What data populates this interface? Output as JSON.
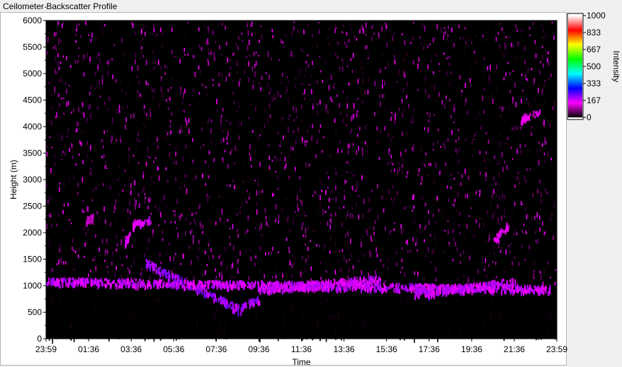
{
  "panel": {
    "title": "Ceilometer Backscatter Profile"
  },
  "chart_data": {
    "type": "heatmap",
    "title": "",
    "xlabel": "Time",
    "ylabel": "Height (m)",
    "x_ticks": [
      "23:59",
      "01:36",
      "03:36",
      "05:36",
      "07:36",
      "09:36",
      "11:36",
      "13:36",
      "15:36",
      "17:36",
      "19:36",
      "21:36",
      "23:59"
    ],
    "y_ticks": [
      0,
      500,
      1000,
      1500,
      2000,
      2500,
      3000,
      3500,
      4000,
      4500,
      5000,
      5500,
      6000
    ],
    "ylim": [
      0,
      6000
    ],
    "colorbar": {
      "label": "Intensity",
      "ticks": [
        1000,
        833,
        667,
        500,
        333,
        167,
        0
      ],
      "range": [
        0,
        1000
      ],
      "colors": [
        "#000000",
        "#ff00ff",
        "#0000ff",
        "#00ffff",
        "#00ff00",
        "#ffff00",
        "#ff0000",
        "#ffffff"
      ]
    },
    "layers": [
      {
        "name": "noise",
        "height_range": [
          1000,
          6000
        ],
        "intensity_range": [
          5,
          160
        ]
      },
      {
        "name": "boundary-layer",
        "height_range": [
          0,
          1000
        ],
        "intensity_range": [
          0,
          15
        ]
      }
    ],
    "features": [
      {
        "time_range": [
          "04:40",
          "09:10"
        ],
        "height_range": [
          1450,
          550
        ],
        "intensity": 200
      },
      {
        "time_range": [
          "09:10",
          "10:00"
        ],
        "height_range": [
          600,
          780
        ],
        "intensity": 190
      },
      {
        "time_range": [
          "10:00",
          "15:40"
        ],
        "height_range": [
          950,
          1150
        ],
        "intensity": 170
      },
      {
        "time_range": [
          "17:15",
          "22:00"
        ],
        "height_range": [
          850,
          1100
        ],
        "intensity": 175
      },
      {
        "time_range": [
          "23:40",
          "23:59"
        ],
        "height_range": [
          950,
          1100
        ],
        "intensity": 175
      },
      {
        "time_range": [
          "04:00",
          "04:50"
        ],
        "height_range": [
          2150,
          2250
        ],
        "intensity": 160
      },
      {
        "time_range": [
          "03:40",
          "04:10"
        ],
        "height_range": [
          1800,
          2250
        ],
        "intensity": 150
      },
      {
        "time_range": [
          "01:50",
          "02:10"
        ],
        "height_range": [
          2250,
          2320
        ],
        "intensity": 120
      },
      {
        "time_range": [
          "21:00",
          "21:40"
        ],
        "height_range": [
          1900,
          2150
        ],
        "intensity": 150
      },
      {
        "time_range": [
          "22:15",
          "23:10"
        ],
        "height_range": [
          4150,
          4300
        ],
        "intensity": 140
      }
    ]
  }
}
